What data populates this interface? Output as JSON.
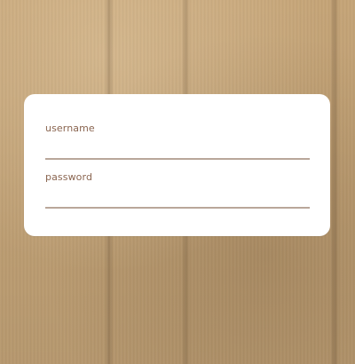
{
  "background": {
    "name": "cardboard"
  },
  "login": {
    "username": {
      "label": "username",
      "value": "",
      "placeholder": ""
    },
    "password": {
      "label": "password",
      "value": "",
      "placeholder": ""
    }
  },
  "colors": {
    "label": "#8a6550",
    "underline": "#b9a79a",
    "card": "#ffffff"
  }
}
